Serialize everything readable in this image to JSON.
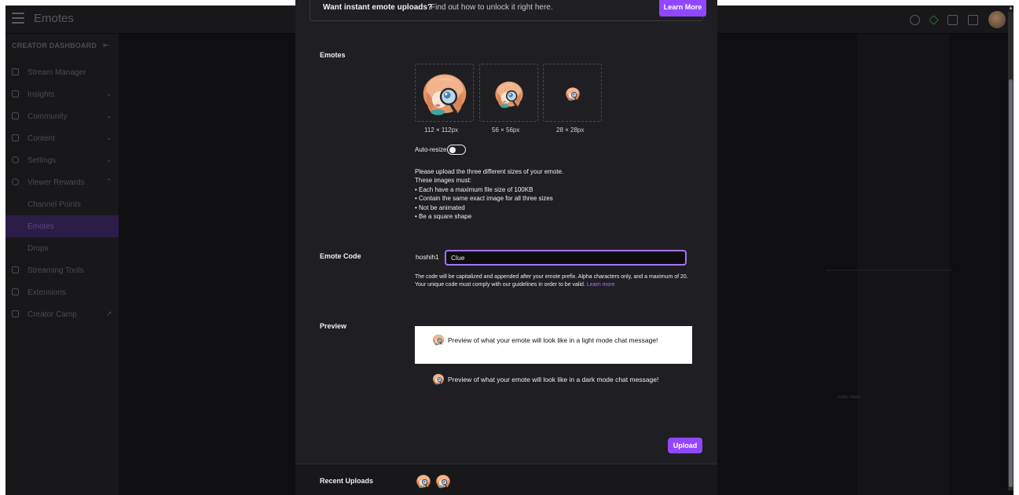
{
  "topbar": {
    "title": "Emotes",
    "icons": [
      "menu-icon",
      "help-icon",
      "creator-icon",
      "inbox-icon",
      "chat-icon",
      "avatar"
    ]
  },
  "sidebar": {
    "header": "CREATOR DASHBOARD",
    "items": [
      {
        "label": "Stream Manager",
        "icon": "broadcast-icon",
        "chevron": ""
      },
      {
        "label": "Insights",
        "icon": "insights-icon",
        "chevron": "⌄"
      },
      {
        "label": "Community",
        "icon": "community-icon",
        "chevron": "⌄"
      },
      {
        "label": "Content",
        "icon": "content-icon",
        "chevron": "⌄"
      },
      {
        "label": "Settings",
        "icon": "gear-icon",
        "chevron": "⌄"
      },
      {
        "label": "Viewer Rewards",
        "icon": "rewards-icon",
        "chevron": "⌃"
      },
      {
        "label": "Channel Points",
        "icon": "",
        "chevron": ""
      },
      {
        "label": "Emotes",
        "icon": "",
        "chevron": ""
      },
      {
        "label": "Drops",
        "icon": "",
        "chevron": ""
      },
      {
        "label": "Streaming Tools",
        "icon": "camera-icon",
        "chevron": ""
      },
      {
        "label": "Extensions",
        "icon": "extensions-icon",
        "chevron": ""
      },
      {
        "label": "Creator Camp",
        "icon": "book-icon",
        "chevron": "↗"
      }
    ]
  },
  "background": {
    "fragment_text": "notes here."
  },
  "modal": {
    "banner": {
      "strong_text": "Want instant emote uploads?",
      "text": "Find out how to unlock it right here.",
      "button": "Learn More"
    },
    "emotes": {
      "label": "Emotes",
      "sizes": [
        "112 × 112px",
        "56 × 56px",
        "28 × 28px"
      ],
      "auto_resize_label": "Auto-resize",
      "auto_resize_on": false,
      "info_lines": [
        "Please upload the three different sizes of your emote.",
        "These images must:",
        "• Each have a maximum file size of 100KB",
        "• Contain the same exact image for all three sizes",
        "• Not be animated",
        "• Be a square shape"
      ]
    },
    "emote_code": {
      "label": "Emote Code",
      "prefix": "hoshih1",
      "value": "Clue",
      "help_text": "The code will be capitalized and appended after your emote prefix. Alpha characters only, and a maximum of 20. Your unique code must comply with our guidelines in order to be valid.",
      "help_link": "Learn more"
    },
    "preview": {
      "label": "Preview",
      "light_text": "Preview of what your emote will look like in a light mode chat message!",
      "dark_text": "Preview of what your emote will look like in a dark mode chat message!"
    },
    "upload_button": "Upload",
    "recent_uploads": {
      "label": "Recent Uploads",
      "count": 2
    }
  },
  "colors": {
    "accent": "#9147ff",
    "input_focus": "#a970ff",
    "modal_bg": "#1f1f23",
    "page_bg": "#0e0e10"
  }
}
